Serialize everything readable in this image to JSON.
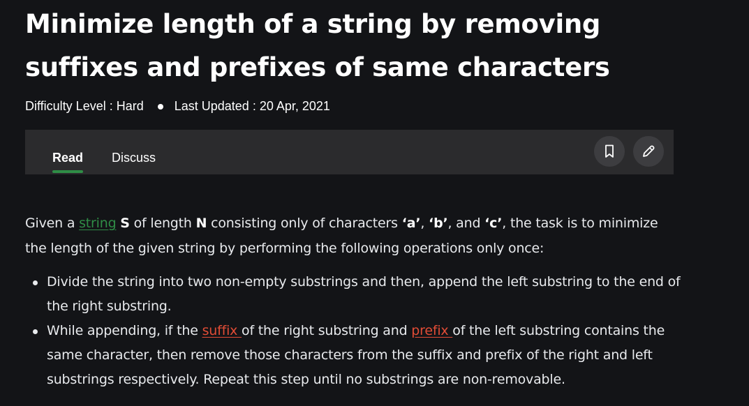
{
  "article": {
    "title": "Minimize length of a string by removing suffixes and prefixes of same characters",
    "difficulty": "Difficulty Level : Hard",
    "last_updated": "Last Updated : 20 Apr, 2021"
  },
  "tabs": {
    "read": "Read",
    "discuss": "Discuss"
  },
  "icons": {
    "bookmark": "bookmark-icon",
    "edit": "pencil-icon"
  },
  "content": {
    "intro": {
      "t1": "Given a ",
      "link_string": "string",
      "t2": " ",
      "b_s": "S",
      "t3": " of length ",
      "b_n": "N",
      "t4": " consisting only of characters ",
      "b_a": "‘a’",
      "t5": ", ",
      "b_b": "‘b’",
      "t6": ", and ",
      "b_c": "‘c’",
      "t7": ", the task is to minimize the length of the given string by performing the following operations only once:"
    },
    "step1": "Divide the string into two non-empty substrings and then, append the left substring to the end of the right substring.",
    "step2": {
      "t1": "While appending, if the ",
      "link_suffix": "suffix ",
      "t2": "of the right substring and ",
      "link_prefix": "prefix ",
      "t3": "of the left substring contains the same character, then remove those characters from the suffix and prefix of the right and left substrings respectively. Repeat this step until no substrings are non-removable."
    }
  },
  "colors": {
    "background": "#131417",
    "toolbar": "#2b2b2d",
    "accent_green": "#2f8d46",
    "link_red": "#e14c36"
  }
}
